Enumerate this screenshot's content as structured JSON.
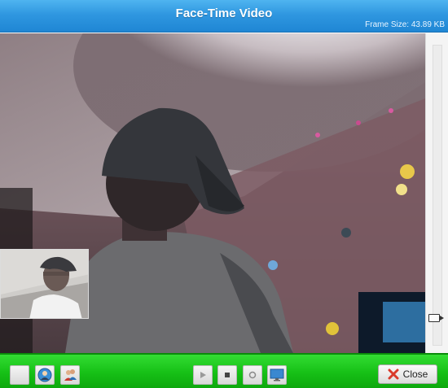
{
  "window": {
    "title": "Face-Time Video",
    "frame_size": "Frame Size: 43.89 KB"
  },
  "video": {
    "remote_feed": "webcam-feed",
    "self_view": "self-view-thumbnail"
  },
  "slider": {
    "level": 0.92
  },
  "toolbar": {
    "left_buttons": [
      "blank-icon",
      "globe-user-icon",
      "users-icon"
    ],
    "media_buttons": [
      "play-icon",
      "stop-icon",
      "record-icon",
      "monitor-icon"
    ],
    "close_label": "Close"
  },
  "colors": {
    "title_bar": "#2f97e0",
    "toolbar": "#16c016",
    "close_x": "#d93a2b"
  }
}
